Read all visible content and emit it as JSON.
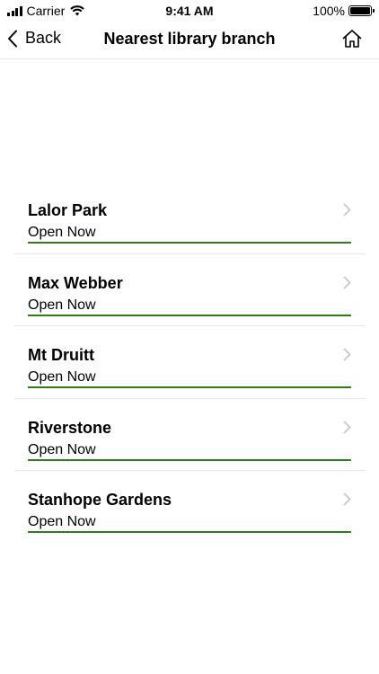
{
  "status_bar": {
    "carrier": "Carrier",
    "time": "9:41 AM",
    "battery": "100%"
  },
  "nav": {
    "back_label": "Back",
    "title": "Nearest library branch"
  },
  "branches": [
    {
      "name": "Lalor Park",
      "status": "Open Now"
    },
    {
      "name": "Max Webber",
      "status": "Open Now"
    },
    {
      "name": "Mt Druitt",
      "status": "Open Now"
    },
    {
      "name": "Riverstone",
      "status": "Open Now"
    },
    {
      "name": "Stanhope Gardens",
      "status": "Open Now"
    }
  ],
  "colors": {
    "open_status_line": "#2e7d16",
    "chevron": "#c7c7cc"
  },
  "icons": {
    "back": "chevron-left-icon",
    "home": "home-icon",
    "row": "chevron-right-icon"
  }
}
